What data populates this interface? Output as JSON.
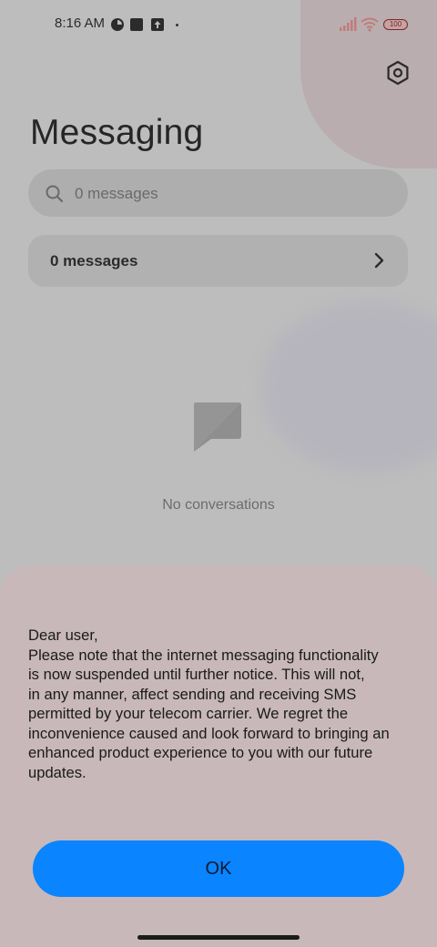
{
  "status_bar": {
    "time": "8:16 AM",
    "battery": "100"
  },
  "header": {
    "title": "Messaging",
    "settings_icon": "gear-hexagon-icon"
  },
  "search": {
    "placeholder": "0 messages"
  },
  "messages_row": {
    "label": "0 messages"
  },
  "empty_state": {
    "text": "No conversations"
  },
  "dialog": {
    "lines": [
      "Dear user,",
      "Please note that the internet messaging functionality",
      "is now suspended until further notice. This will not,",
      "in any manner, affect sending and receiving SMS",
      "permitted by your telecom carrier. We regret the",
      "inconvenience caused and look forward to bringing an",
      "enhanced product experience to you with our future",
      "updates."
    ],
    "ok_label": "OK"
  },
  "colors": {
    "accent": "#0a84ff",
    "sheet": "#c8b8b9"
  }
}
